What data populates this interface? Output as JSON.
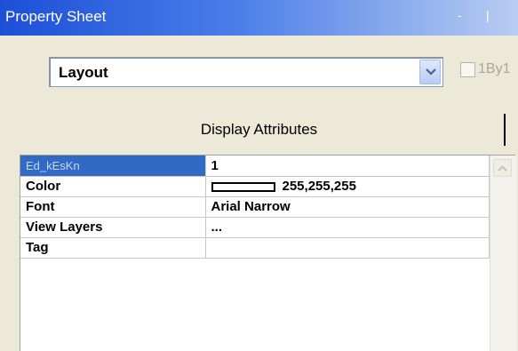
{
  "window": {
    "title": "Property Sheet",
    "title_buttons": [
      "-",
      "|"
    ]
  },
  "combo": {
    "value": "Layout",
    "icon": "chevron-down-icon"
  },
  "checkbox": {
    "label": "1By1",
    "checked": false,
    "enabled": false
  },
  "section": {
    "title": "Display Attributes"
  },
  "properties": [
    {
      "name": "Ed_kEsKn",
      "value": "1",
      "selected": true
    },
    {
      "name": "Color",
      "value": "255,255,255",
      "swatch": "#ffffff"
    },
    {
      "name": "Font",
      "value": "Arial Narrow"
    },
    {
      "name": "View Layers",
      "value": "..."
    },
    {
      "name": "Tag",
      "value": ""
    }
  ],
  "colors": {
    "titlebar": "#1c4fd6",
    "selection": "#316ac5",
    "window_bg": "#ece9d8"
  }
}
